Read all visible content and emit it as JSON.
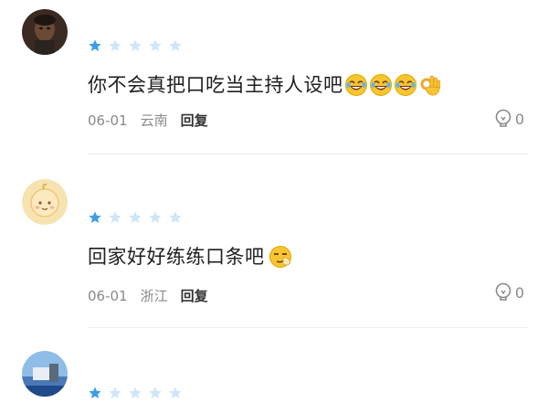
{
  "comments": [
    {
      "avatar": "person-photo-avatar",
      "rating": 1,
      "rating_max": 5,
      "text": "你不会真把口吃当主持人设吧",
      "emojis": [
        "rofl-emoji",
        "rofl-emoji",
        "rofl-emoji",
        "ok-hand-emoji"
      ],
      "date": "06-01",
      "location": "云南",
      "reply_label": "回复",
      "likes": "0"
    },
    {
      "avatar": "cartoon-baby-avatar",
      "rating": 1,
      "rating_max": 5,
      "text": "回家好好练练口条吧",
      "emojis": [
        "smirk-emoji"
      ],
      "date": "06-01",
      "location": "浙江",
      "reply_label": "回复",
      "likes": "0"
    },
    {
      "avatar": "landscape-photo-avatar",
      "rating": 1,
      "rating_max": 5
    }
  ],
  "colors": {
    "star_filled": "#3d9ee8",
    "star_empty": "#cfe6f8",
    "text": "#1f1f1f",
    "meta": "#8a8a8a",
    "reply": "#333333"
  },
  "icons": {
    "like": "lightbulb-like-icon",
    "star": "star-icon"
  }
}
